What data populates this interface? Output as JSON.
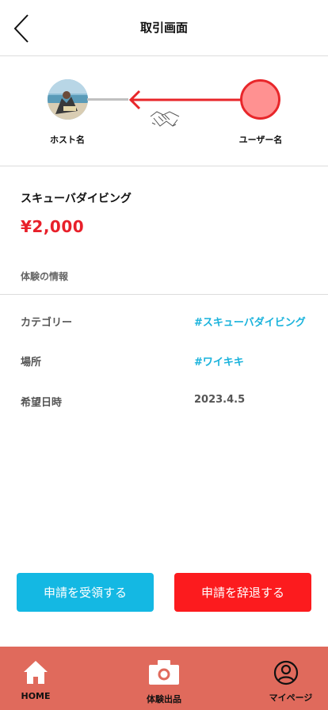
{
  "header": {
    "title": "取引画面"
  },
  "parties": {
    "host_name": "ホスト名",
    "user_name": "ユーザー名",
    "arrow_color": "#e8262a",
    "user_avatar_color": "#ff9191"
  },
  "experience": {
    "title": "スキューバダイビング",
    "price": "¥2,000",
    "section_label": "体験の情報",
    "rows": [
      {
        "key": "カテゴリー",
        "value": "#スキューバダイビング"
      },
      {
        "key": "場所",
        "value": "#ワイキキ"
      },
      {
        "key": "希望日時",
        "value": "2023.4.5"
      }
    ]
  },
  "actions": {
    "accept_label": "申請を受領する",
    "decline_label": "申請を辞退する",
    "accept_color": "#14b8e3",
    "decline_color": "#fc1b1e"
  },
  "bottom_nav": {
    "background": "#e06a5c",
    "items": [
      {
        "label": "HOME",
        "icon": "home-icon"
      },
      {
        "label": "体験出品",
        "icon": "camera-icon"
      },
      {
        "label": "マイページ",
        "icon": "user-circle-icon"
      }
    ]
  }
}
